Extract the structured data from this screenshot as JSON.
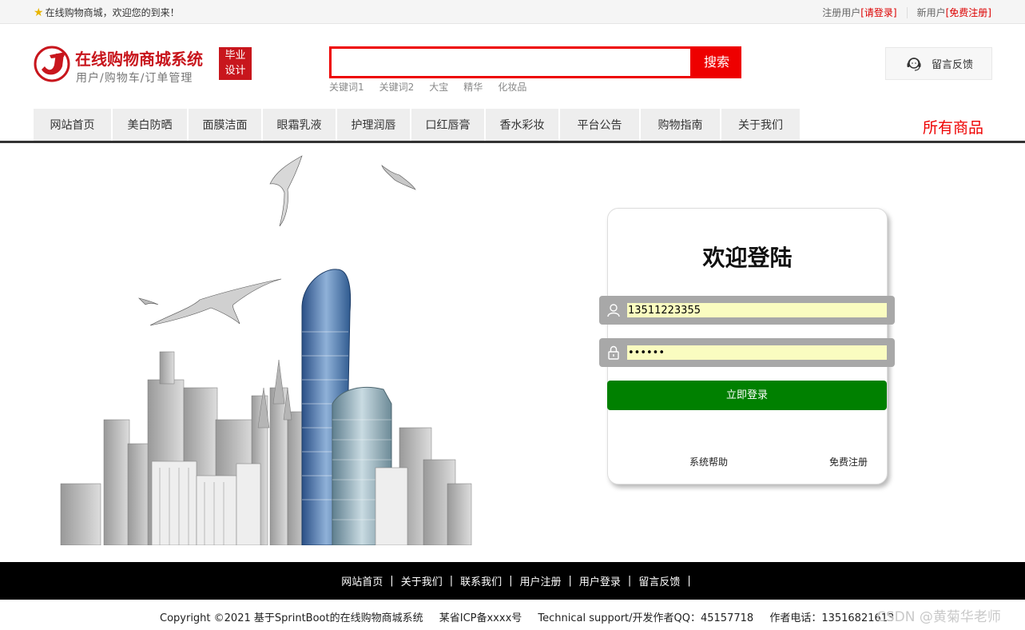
{
  "topbar": {
    "welcome": "在线购物商城，欢迎您的到来！",
    "register_label": "注册用户",
    "login_link": "[请登录]",
    "newuser_label": "新用户",
    "free_register_link": "[免费注册]"
  },
  "header": {
    "logo_title": "在线购物商城系统",
    "logo_subtitle": "用户/购物车/订单管理",
    "badge_line1": "毕业",
    "badge_line2": "设计",
    "search_button": "搜索",
    "search_value": "",
    "keywords": [
      "关键词1",
      "关键词2",
      "大宝",
      "精华",
      "化妆品"
    ],
    "feedback_button": "留言反馈"
  },
  "nav": {
    "items": [
      "网站首页",
      "美白防晒",
      "面膜洁面",
      "眼霜乳液",
      "护理润唇",
      "口红唇膏",
      "香水彩妆",
      "平台公告",
      "购物指南",
      "关于我们"
    ],
    "all_goods": "所有商品"
  },
  "login": {
    "title": "欢迎登陆",
    "username_value": "13511223355",
    "password_value": "••••••",
    "submit_label": "立即登录",
    "help_link": "系统帮助",
    "register_link": "免费注册"
  },
  "footer": {
    "links": [
      "网站首页",
      "关于我们",
      "联系我们",
      "用户注册",
      "用户登录",
      "留言反馈"
    ],
    "copyright": "Copyright ©2021 基于SprintBoot的在线购物商城系统",
    "icp": "某省ICP备xxxx号",
    "support": "Technical support/开发作者QQ：45157718",
    "phone": "作者电话：13516821613"
  },
  "watermark": "CSDN @黄菊华老师",
  "icons": {
    "star": "star-icon",
    "logo": "logo-icon",
    "headset": "headset-icon",
    "user": "user-icon",
    "lock": "lock-icon"
  },
  "colors": {
    "brand_red": "#c8161d",
    "search_red": "#e00000",
    "login_green": "#008000",
    "footer_black": "#000000"
  }
}
